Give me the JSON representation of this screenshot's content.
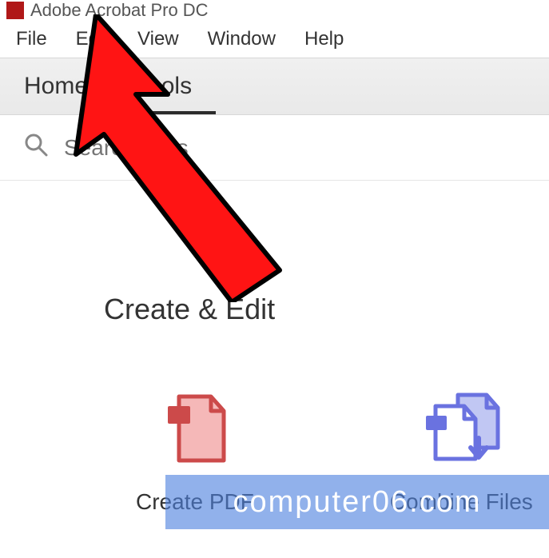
{
  "titlebar": {
    "app_title": "Adobe Acrobat Pro DC"
  },
  "menubar": {
    "items": [
      {
        "label": "File"
      },
      {
        "label": "Edit"
      },
      {
        "label": "View"
      },
      {
        "label": "Window"
      },
      {
        "label": "Help"
      }
    ]
  },
  "tabbar": {
    "tabs": [
      {
        "label": "Home",
        "active": false
      },
      {
        "label": "Tools",
        "active": true
      }
    ]
  },
  "search": {
    "placeholder": "Search tools"
  },
  "section": {
    "title": "Create & Edit"
  },
  "tools": [
    {
      "label": "Create PDF"
    },
    {
      "label": "Combine Files"
    }
  ],
  "watermark": {
    "text": "computer06.com"
  },
  "colors": {
    "acrobat_red": "#b01818",
    "tool_red_fill": "#f5b8b8",
    "tool_red_line": "#cc4a4a",
    "tool_blue_fill": "#c1c7f3",
    "tool_blue_line": "#6a72e0",
    "arrow_red": "#ff1414"
  }
}
